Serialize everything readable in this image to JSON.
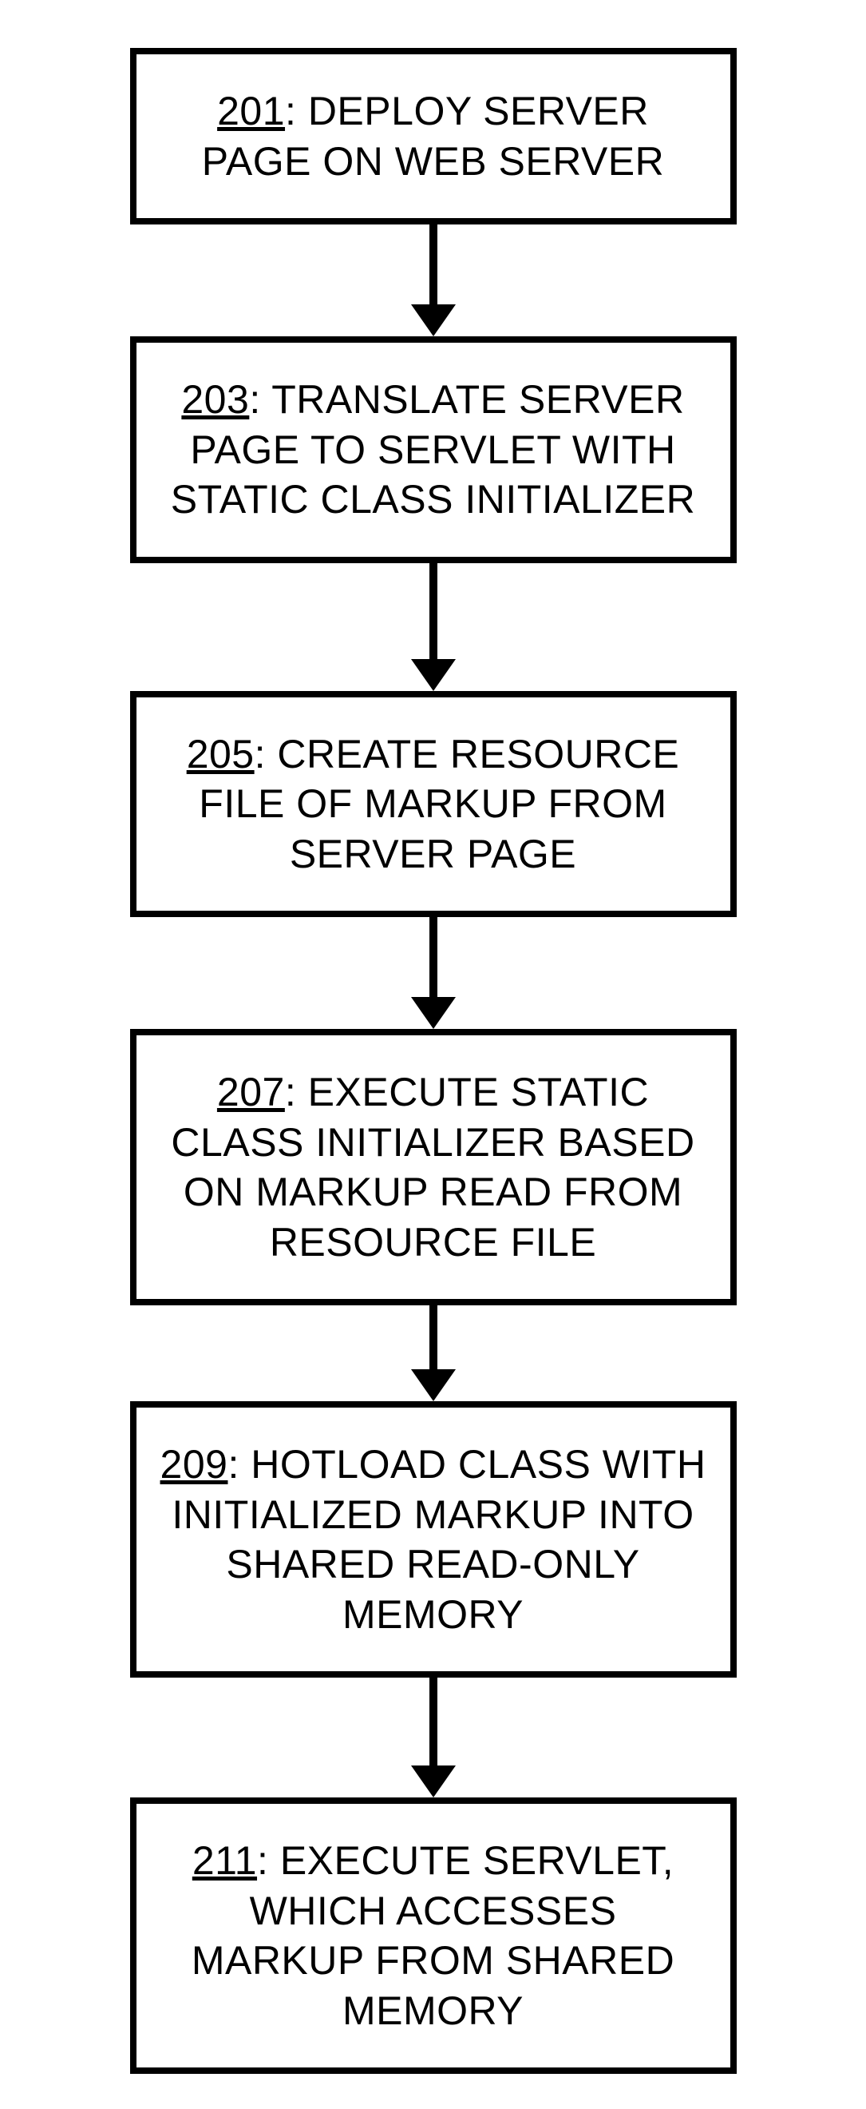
{
  "chart_data": {
    "type": "flowchart",
    "direction": "top-to-bottom",
    "nodes": [
      {
        "id": "201",
        "text": "DEPLOY SERVER PAGE ON WEB SERVER"
      },
      {
        "id": "203",
        "text": "TRANSLATE SERVER PAGE TO SERVLET WITH STATIC CLASS INITIALIZER"
      },
      {
        "id": "205",
        "text": "CREATE RESOURCE FILE OF MARKUP FROM SERVER PAGE"
      },
      {
        "id": "207",
        "text": "EXECUTE STATIC CLASS INITIALIZER BASED ON MARKUP READ FROM RESOURCE FILE"
      },
      {
        "id": "209",
        "text": "HOTLOAD CLASS WITH INITIALIZED MARKUP INTO SHARED READ-ONLY MEMORY"
      },
      {
        "id": "211",
        "text": "EXECUTE SERVLET, WHICH ACCESSES MARKUP FROM SHARED MEMORY"
      }
    ],
    "edges": [
      {
        "from": "201",
        "to": "203"
      },
      {
        "from": "203",
        "to": "205"
      },
      {
        "from": "205",
        "to": "207"
      },
      {
        "from": "207",
        "to": "209"
      },
      {
        "from": "209",
        "to": "211"
      }
    ]
  },
  "arrow_heights": [
    100,
    120,
    100,
    80,
    110
  ]
}
